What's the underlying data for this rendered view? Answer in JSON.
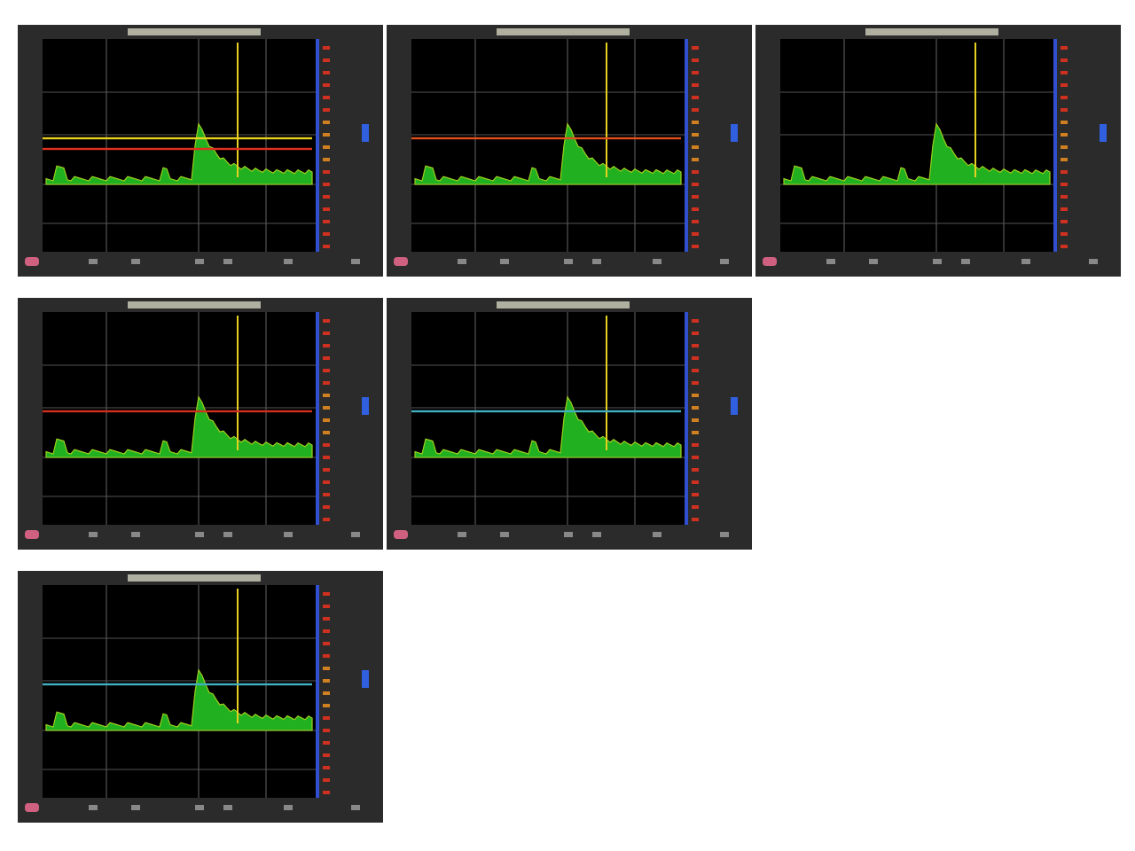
{
  "panels": [
    {
      "kind": "scope",
      "thresholds": [
        {
          "color": "#e8d020"
        },
        {
          "color": "#e03020"
        }
      ]
    },
    {
      "kind": "scope",
      "thresholds": [
        {
          "color": "#e05020"
        }
      ]
    },
    {
      "kind": "scope"
    },
    {
      "kind": "scope",
      "thresholds": [
        {
          "color": "#d03020"
        }
      ]
    },
    {
      "kind": "scope",
      "thresholds": [
        {
          "color": "#40b0c0"
        }
      ]
    },
    {
      "kind": "scope",
      "thresholds": [
        {
          "color": "#40b0c0"
        }
      ]
    }
  ]
}
